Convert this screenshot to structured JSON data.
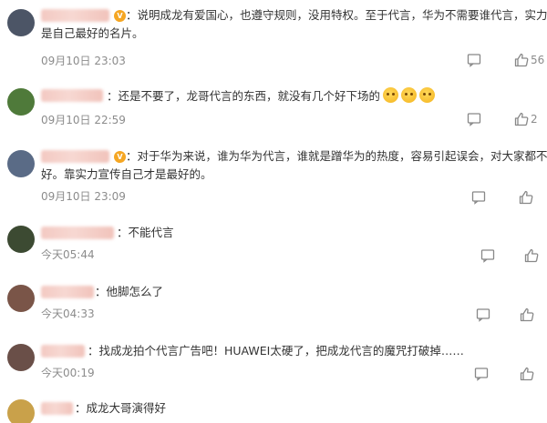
{
  "comments": [
    {
      "text_line1": "：说明成龙有爱国心，也遵守规则，没用特权。至于代言，华为不需要谁代言，实力就",
      "text_line2": "是自己最好的名片。",
      "time": "09月10日 23:03",
      "like_count": "56",
      "has_vip": true,
      "avatar_color": "#4c5566"
    },
    {
      "text_line1": "：还是不要了，龙哥代言的东西，就没有几个好下场的",
      "emoji_count": 3,
      "time": "09月10日 22:59",
      "like_count": "2",
      "has_vip": false,
      "avatar_color": "#4f7a3a"
    },
    {
      "text_line1": "：对于华为来说，谁为华为代言，谁就是蹭华为的热度，容易引起误会，对大家都不",
      "text_line2": "好。靠实力宣传自己才是最好的。",
      "time": "09月10日 23:09",
      "like_count": "",
      "has_vip": true,
      "avatar_color": "#5a6b86"
    },
    {
      "text_line1": "：不能代言",
      "time": "今天05:44",
      "like_count": "",
      "has_vip": false,
      "avatar_color": "#3c4a32"
    },
    {
      "text_line1": "：他脚怎么了",
      "time": "今天04:33",
      "like_count": "",
      "has_vip": false,
      "avatar_color": "#7a5548"
    },
    {
      "text_line1": "：找成龙拍个代言广告吧！HUAWEI太硬了，把成龙代言的魔咒打破掉……",
      "time": "今天00:19",
      "like_count": "",
      "has_vip": false,
      "avatar_color": "#6a4f48"
    },
    {
      "text_line1": "：成龙大哥演得好",
      "time": "",
      "like_count": "",
      "has_vip": false,
      "avatar_color": "#c9a14a"
    }
  ],
  "icons": {
    "reply": "comment-icon",
    "like": "thumbs-up-icon",
    "vip": "vip-badge-icon"
  }
}
